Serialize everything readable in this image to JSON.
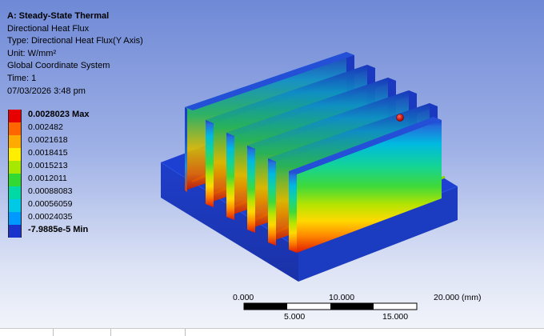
{
  "details": {
    "title": "A: Steady-State Thermal",
    "result_name": "Directional Heat Flux",
    "type": "Type: Directional Heat Flux(Y Axis)",
    "unit": "Unit: W/mm²",
    "coordinate_system": "Global Coordinate System",
    "time": "Time: 1",
    "timestamp": "07/03/2026 3:48 pm"
  },
  "legend": {
    "entries": [
      {
        "label": "0.0028023 Max",
        "color": "#e60000"
      },
      {
        "label": "0.002482",
        "color": "#ff6600"
      },
      {
        "label": "0.0021618",
        "color": "#ffaa00"
      },
      {
        "label": "0.0018415",
        "color": "#ffee00"
      },
      {
        "label": "0.0015213",
        "color": "#a6e800"
      },
      {
        "label": "0.0012011",
        "color": "#33d933"
      },
      {
        "label": "0.00088083",
        "color": "#00d9a6"
      },
      {
        "label": "0.00056059",
        "color": "#00c9e6"
      },
      {
        "label": "0.00024035",
        "color": "#0099ff"
      },
      {
        "label": "-7.9885e-5 Min",
        "color": "#1a33cc"
      }
    ]
  },
  "scale_bar": {
    "top_labels": [
      "0.000",
      "10.000",
      "20.000 (mm)"
    ],
    "bottom_labels": [
      "5.000",
      "15.000"
    ]
  }
}
